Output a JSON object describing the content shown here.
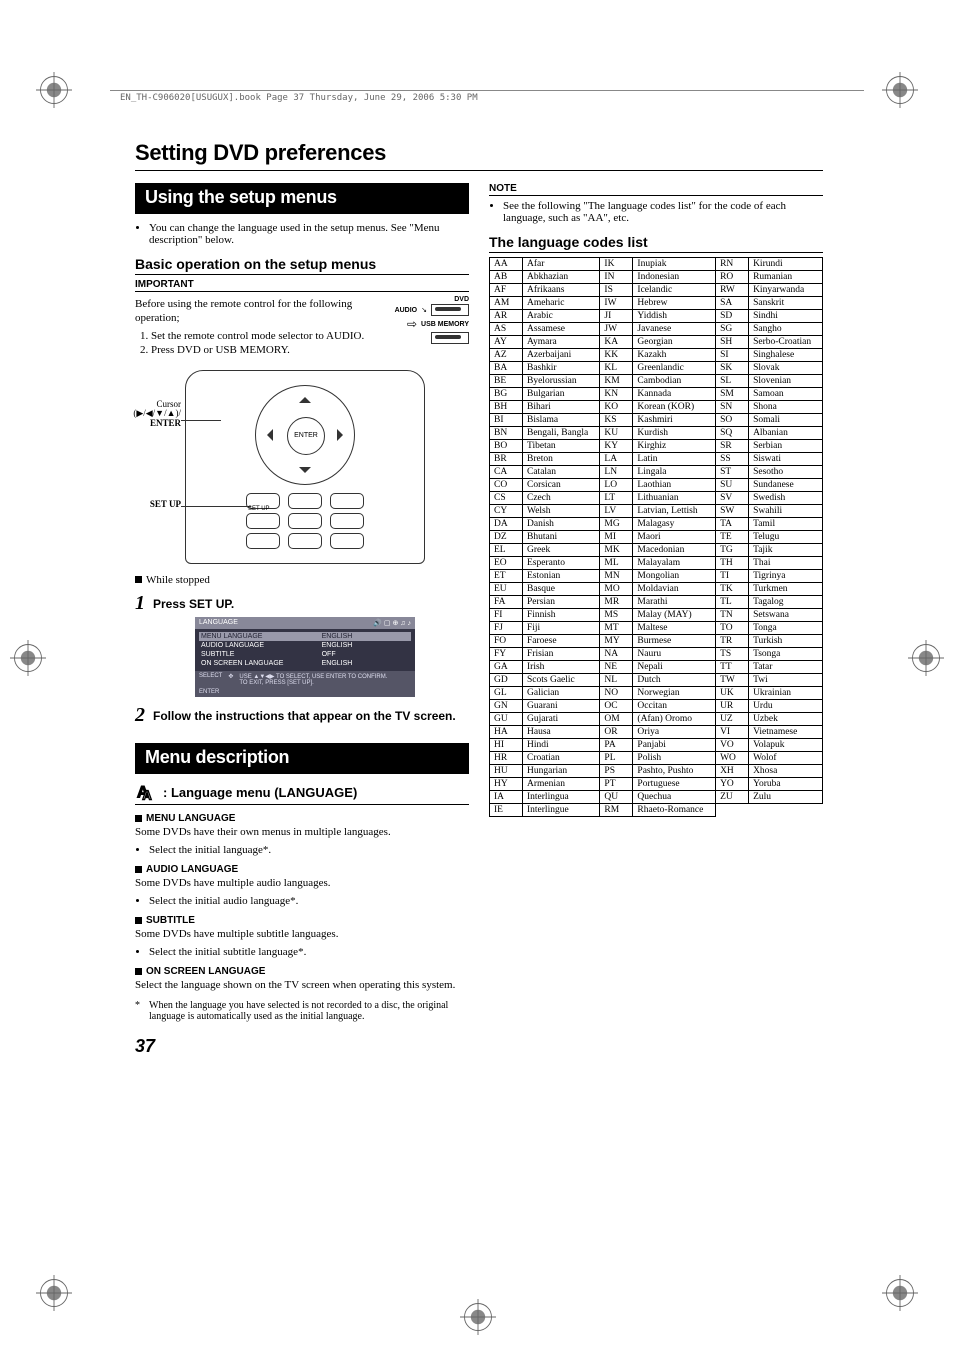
{
  "header_line": "EN_TH-C906020[USUGUX].book  Page 37  Thursday, June 29, 2006  5:30 PM",
  "main_title": "Setting DVD preferences",
  "box_using": "Using the setup menus",
  "using_desc": "You can change the language used in the setup menus. See \"Menu description\" below.",
  "basic_heading": "Basic operation on the setup menus",
  "important_label": "IMPORTANT",
  "important_text": "Before using the remote control for the following operation;",
  "prep_steps": [
    "Set the remote control mode selector to AUDIO.",
    "Press DVD or USB MEMORY."
  ],
  "switch": {
    "audio": "AUDIO",
    "dvd": "DVD",
    "usb": "USB MEMORY"
  },
  "remote": {
    "cursor_label": "Cursor",
    "cursor_sym": "(▶/◀/▼/▲)/",
    "enter": "ENTER",
    "setup": "SET UP",
    "enter_btn": "ENTER",
    "setup_btn": "SET UP"
  },
  "while_stopped": "While stopped",
  "step1": "Press SET UP.",
  "osd": {
    "title": "LANGUAGE",
    "rows": [
      {
        "k": "MENU LANGUAGE",
        "v": "ENGLISH"
      },
      {
        "k": "AUDIO LANGUAGE",
        "v": "ENGLISH"
      },
      {
        "k": "SUBTITLE",
        "v": "OFF"
      },
      {
        "k": "ON SCREEN LANGUAGE",
        "v": "ENGLISH"
      }
    ],
    "hint_select": "SELECT",
    "hint_enter": "ENTER",
    "hint_text1": "USE ▲▼◀▶ TO SELECT, USE ENTER TO CONFIRM.",
    "hint_text2": "TO EXIT, PRESS [SET UP]."
  },
  "step2": "Follow the instructions that appear on the TV screen.",
  "box_menu": "Menu description",
  "lang_menu_heading": ": Language menu (LANGUAGE)",
  "sections": {
    "menu_lang": {
      "h": "MENU LANGUAGE",
      "p": "Some DVDs have their own menus in multiple languages.",
      "b": "Select the initial language*."
    },
    "audio_lang": {
      "h": "AUDIO LANGUAGE",
      "p": "Some DVDs have multiple audio languages.",
      "b": "Select the initial audio language*."
    },
    "subtitle": {
      "h": "SUBTITLE",
      "p": "Some DVDs have multiple subtitle languages.",
      "b": "Select the initial subtitle language*."
    },
    "onscreen": {
      "h": "ON SCREEN LANGUAGE",
      "p": "Select the language shown on the TV screen when operating this system."
    }
  },
  "footnote": "When the language you have selected is not recorded to a disc, the original language is automatically used as the initial language.",
  "page_number": "37",
  "note_label": "NOTE",
  "note_text": "See the following \"The language codes list\" for the code of each language, such as \"AA\", etc.",
  "codes_heading": "The language codes list",
  "codes_col1": [
    [
      "AA",
      "Afar"
    ],
    [
      "AB",
      "Abkhazian"
    ],
    [
      "AF",
      "Afrikaans"
    ],
    [
      "AM",
      "Ameharic"
    ],
    [
      "AR",
      "Arabic"
    ],
    [
      "AS",
      "Assamese"
    ],
    [
      "AY",
      "Aymara"
    ],
    [
      "AZ",
      "Azerbaijani"
    ],
    [
      "BA",
      "Bashkir"
    ],
    [
      "BE",
      "Byelorussian"
    ],
    [
      "BG",
      "Bulgarian"
    ],
    [
      "BH",
      "Bihari"
    ],
    [
      "BI",
      "Bislama"
    ],
    [
      "BN",
      "Bengali, Bangla"
    ],
    [
      "BO",
      "Tibetan"
    ],
    [
      "BR",
      "Breton"
    ],
    [
      "CA",
      "Catalan"
    ],
    [
      "CO",
      "Corsican"
    ],
    [
      "CS",
      "Czech"
    ],
    [
      "CY",
      "Welsh"
    ],
    [
      "DA",
      "Danish"
    ],
    [
      "DZ",
      "Bhutani"
    ],
    [
      "EL",
      "Greek"
    ],
    [
      "EO",
      "Esperanto"
    ],
    [
      "ET",
      "Estonian"
    ],
    [
      "EU",
      "Basque"
    ],
    [
      "FA",
      "Persian"
    ],
    [
      "FI",
      "Finnish"
    ],
    [
      "FJ",
      "Fiji"
    ],
    [
      "FO",
      "Faroese"
    ],
    [
      "FY",
      "Frisian"
    ],
    [
      "GA",
      "Irish"
    ],
    [
      "GD",
      "Scots Gaelic"
    ],
    [
      "GL",
      "Galician"
    ],
    [
      "GN",
      "Guarani"
    ],
    [
      "GU",
      "Gujarati"
    ],
    [
      "HA",
      "Hausa"
    ],
    [
      "HI",
      "Hindi"
    ],
    [
      "HR",
      "Croatian"
    ],
    [
      "HU",
      "Hungarian"
    ],
    [
      "HY",
      "Armenian"
    ],
    [
      "IA",
      "Interlingua"
    ],
    [
      "IE",
      "Interlingue"
    ]
  ],
  "codes_col2": [
    [
      "IK",
      "Inupiak"
    ],
    [
      "IN",
      "Indonesian"
    ],
    [
      "IS",
      "Icelandic"
    ],
    [
      "IW",
      "Hebrew"
    ],
    [
      "JI",
      "Yiddish"
    ],
    [
      "JW",
      "Javanese"
    ],
    [
      "KA",
      "Georgian"
    ],
    [
      "KK",
      "Kazakh"
    ],
    [
      "KL",
      "Greenlandic"
    ],
    [
      "KM",
      "Cambodian"
    ],
    [
      "KN",
      "Kannada"
    ],
    [
      "KO",
      "Korean (KOR)"
    ],
    [
      "KS",
      "Kashmiri"
    ],
    [
      "KU",
      "Kurdish"
    ],
    [
      "KY",
      "Kirghiz"
    ],
    [
      "LA",
      "Latin"
    ],
    [
      "LN",
      "Lingala"
    ],
    [
      "LO",
      "Laothian"
    ],
    [
      "LT",
      "Lithuanian"
    ],
    [
      "LV",
      "Latvian, Lettish"
    ],
    [
      "MG",
      "Malagasy"
    ],
    [
      "MI",
      "Maori"
    ],
    [
      "MK",
      "Macedonian"
    ],
    [
      "ML",
      "Malayalam"
    ],
    [
      "MN",
      "Mongolian"
    ],
    [
      "MO",
      "Moldavian"
    ],
    [
      "MR",
      "Marathi"
    ],
    [
      "MS",
      "Malay (MAY)"
    ],
    [
      "MT",
      "Maltese"
    ],
    [
      "MY",
      "Burmese"
    ],
    [
      "NA",
      "Nauru"
    ],
    [
      "NE",
      "Nepali"
    ],
    [
      "NL",
      "Dutch"
    ],
    [
      "NO",
      "Norwegian"
    ],
    [
      "OC",
      "Occitan"
    ],
    [
      "OM",
      "(Afan) Oromo"
    ],
    [
      "OR",
      "Oriya"
    ],
    [
      "PA",
      "Panjabi"
    ],
    [
      "PL",
      "Polish"
    ],
    [
      "PS",
      "Pashto, Pushto"
    ],
    [
      "PT",
      "Portuguese"
    ],
    [
      "QU",
      "Quechua"
    ],
    [
      "RM",
      "Rhaeto-Romance"
    ]
  ],
  "codes_col3": [
    [
      "RN",
      "Kirundi"
    ],
    [
      "RO",
      "Rumanian"
    ],
    [
      "RW",
      "Kinyarwanda"
    ],
    [
      "SA",
      "Sanskrit"
    ],
    [
      "SD",
      "Sindhi"
    ],
    [
      "SG",
      "Sangho"
    ],
    [
      "SH",
      "Serbo-Croatian"
    ],
    [
      "SI",
      "Singhalese"
    ],
    [
      "SK",
      "Slovak"
    ],
    [
      "SL",
      "Slovenian"
    ],
    [
      "SM",
      "Samoan"
    ],
    [
      "SN",
      "Shona"
    ],
    [
      "SO",
      "Somali"
    ],
    [
      "SQ",
      "Albanian"
    ],
    [
      "SR",
      "Serbian"
    ],
    [
      "SS",
      "Siswati"
    ],
    [
      "ST",
      "Sesotho"
    ],
    [
      "SU",
      "Sundanese"
    ],
    [
      "SV",
      "Swedish"
    ],
    [
      "SW",
      "Swahili"
    ],
    [
      "TA",
      "Tamil"
    ],
    [
      "TE",
      "Telugu"
    ],
    [
      "TG",
      "Tajik"
    ],
    [
      "TH",
      "Thai"
    ],
    [
      "TI",
      "Tigrinya"
    ],
    [
      "TK",
      "Turkmen"
    ],
    [
      "TL",
      "Tagalog"
    ],
    [
      "TN",
      "Setswana"
    ],
    [
      "TO",
      "Tonga"
    ],
    [
      "TR",
      "Turkish"
    ],
    [
      "TS",
      "Tsonga"
    ],
    [
      "TT",
      "Tatar"
    ],
    [
      "TW",
      "Twi"
    ],
    [
      "UK",
      "Ukrainian"
    ],
    [
      "UR",
      "Urdu"
    ],
    [
      "UZ",
      "Uzbek"
    ],
    [
      "VI",
      "Vietnamese"
    ],
    [
      "VO",
      "Volapuk"
    ],
    [
      "WO",
      "Wolof"
    ],
    [
      "XH",
      "Xhosa"
    ],
    [
      "YO",
      "Yoruba"
    ],
    [
      "ZU",
      "Zulu"
    ]
  ]
}
